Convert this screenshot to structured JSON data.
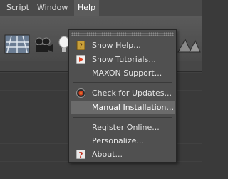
{
  "menubar": {
    "items": [
      {
        "label": "Script"
      },
      {
        "label": "Window"
      },
      {
        "label": "Help"
      }
    ]
  },
  "help_menu": {
    "items": [
      {
        "label": "Show Help...",
        "icon": "help-book-icon"
      },
      {
        "label": "Show Tutorials...",
        "icon": "tutorial-play-icon"
      },
      {
        "label": "MAXON Support...",
        "icon": ""
      },
      {
        "label": "Check for Updates...",
        "icon": "update-check-icon"
      },
      {
        "label": "Manual Installation...",
        "icon": ""
      },
      {
        "label": "Register Online...",
        "icon": ""
      },
      {
        "label": "Personalize...",
        "icon": ""
      },
      {
        "label": "About...",
        "icon": "about-icon"
      }
    ],
    "highlighted_index": 4
  },
  "colors": {
    "menu_bg": "#505050",
    "menu_highlight": "#6b6b6b",
    "toolbar_bg": "#5a5a5a",
    "accent_red": "#e04020"
  }
}
